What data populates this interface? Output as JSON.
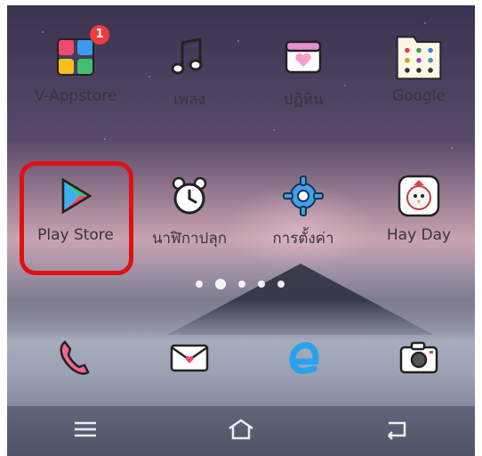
{
  "home": {
    "row1": [
      {
        "label": "V-Appstore",
        "icon": "apps-grid-icon",
        "badge": "1"
      },
      {
        "label": "เพลง",
        "icon": "music-note-icon"
      },
      {
        "label": "ปฏิทิน",
        "icon": "calendar-heart-icon"
      },
      {
        "label": "Google",
        "icon": "google-folder-icon"
      }
    ],
    "row2": [
      {
        "label": "Play Store",
        "icon": "play-store-icon"
      },
      {
        "label": "นาฬิกาปลุก",
        "icon": "alarm-clock-icon"
      },
      {
        "label": "การตั้งค่า",
        "icon": "settings-gear-icon"
      },
      {
        "label": "Hay Day",
        "icon": "hay-day-icon"
      }
    ],
    "page_indicator": {
      "count": 5,
      "active": 1
    }
  },
  "dock": [
    {
      "icon": "phone-icon"
    },
    {
      "icon": "mail-icon"
    },
    {
      "icon": "browser-icon"
    },
    {
      "icon": "camera-icon"
    }
  ],
  "navbar": [
    {
      "icon": "menu-icon"
    },
    {
      "icon": "home-icon"
    },
    {
      "icon": "back-icon"
    }
  ],
  "colors": {
    "highlight": "#e01010",
    "badge": "#ef3b3b"
  }
}
